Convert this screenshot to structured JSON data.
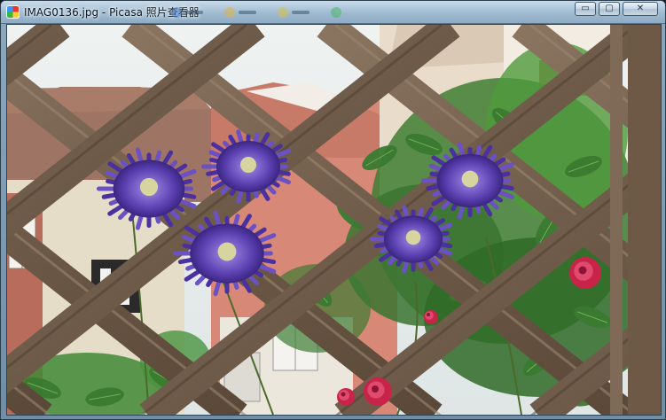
{
  "window": {
    "title": "IMAG0136.jpg - Picasa 照片查看器",
    "controls": {
      "minimize_glyph": "▭",
      "maximize_glyph": "▢",
      "close_glyph": "✕"
    }
  },
  "photo": {
    "subject": "purple double clematis flowers and pink roses climbing a diagonal wooden lattice trellis in front of buildings",
    "colors": {
      "sky": "#eef2f1",
      "wall": "#d88877",
      "roof": "#9e7565",
      "wood": "#75614f",
      "leaf": "#3a7a30",
      "flower": "#5a3fb0",
      "rose": "#c8244a"
    }
  }
}
